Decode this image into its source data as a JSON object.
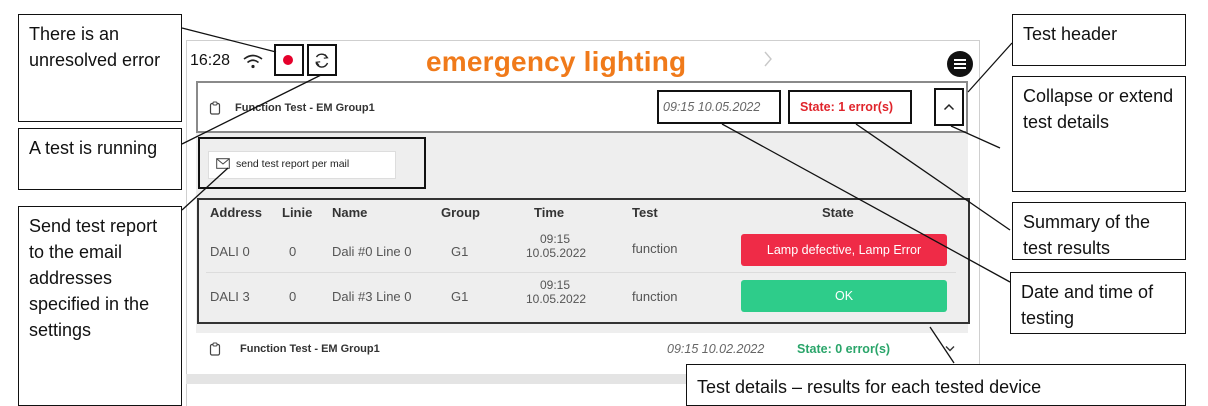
{
  "status_bar": {
    "time": "16:28"
  },
  "app": {
    "title": "emergency lighting"
  },
  "tests": [
    {
      "title": "Function Test - EM Group1",
      "datetime": "09:15 10.05.2022",
      "state": "State: 1 error(s)",
      "state_color": "#e0242b",
      "expanded": true
    },
    {
      "title": "Function Test - EM Group1",
      "datetime": "09:15 10.02.2022",
      "state": "State: 0 error(s)",
      "state_color": "#2aa56a",
      "expanded": false
    }
  ],
  "details": {
    "mail_button": "send test report per mail",
    "columns": [
      "Address",
      "Linie",
      "Name",
      "Group",
      "Time",
      "Test",
      "State"
    ],
    "rows": [
      {
        "address": "DALI 0",
        "linie": "0",
        "name": "Dali #0 Line 0",
        "group": "G1",
        "time_line1": "09:15",
        "time_line2": "10.05.2022",
        "test": "function",
        "state": "Lamp defective, Lamp Error",
        "state_color": "#ef2b47"
      },
      {
        "address": "DALI 3",
        "linie": "0",
        "name": "Dali #3 Line 0",
        "group": "G1",
        "time_line1": "09:15",
        "time_line2": "10.05.2022",
        "test": "function",
        "state": "OK",
        "state_color": "#2ecc8a"
      }
    ]
  },
  "annotations": {
    "unresolved_error": "There is an unresolved error",
    "test_running": "A test is running",
    "send_report": "Send test report to the email addresses specified in the settings",
    "test_header": "Test header",
    "collapse": "Collapse or extend test details",
    "summary": "Summary of the test results",
    "datetime": "Date and time of testing",
    "test_details": "Test details – results for each tested device"
  },
  "colors": {
    "brand": "#f07a1a",
    "error": "#e0242b",
    "ok": "#2aa56a"
  },
  "icons": [
    "wifi-icon",
    "record-icon",
    "sync-icon",
    "chevron-right-icon",
    "menu-icon",
    "clipboard-icon",
    "chevron-up-icon",
    "mail-icon",
    "chevron-down-icon"
  ]
}
